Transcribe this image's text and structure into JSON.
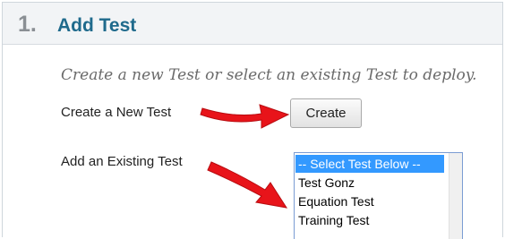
{
  "step": {
    "number": "1.",
    "title": "Add Test"
  },
  "instructions": "Create a new Test or select an existing Test to deploy.",
  "create_new": {
    "label": "Create a New Test",
    "button_label": "Create"
  },
  "add_existing": {
    "label": "Add an Existing Test",
    "options": [
      "-- Select Test Below --",
      "Test Gonz",
      "Equation Test",
      "Training Test"
    ],
    "selected_index": 0
  },
  "colors": {
    "title": "#1f6a8c",
    "step_number": "#8a8f94",
    "selection": "#3399ff",
    "arrow": "#e8141a"
  },
  "icons": [
    "arrow-right-icon",
    "arrow-down-right-icon"
  ]
}
